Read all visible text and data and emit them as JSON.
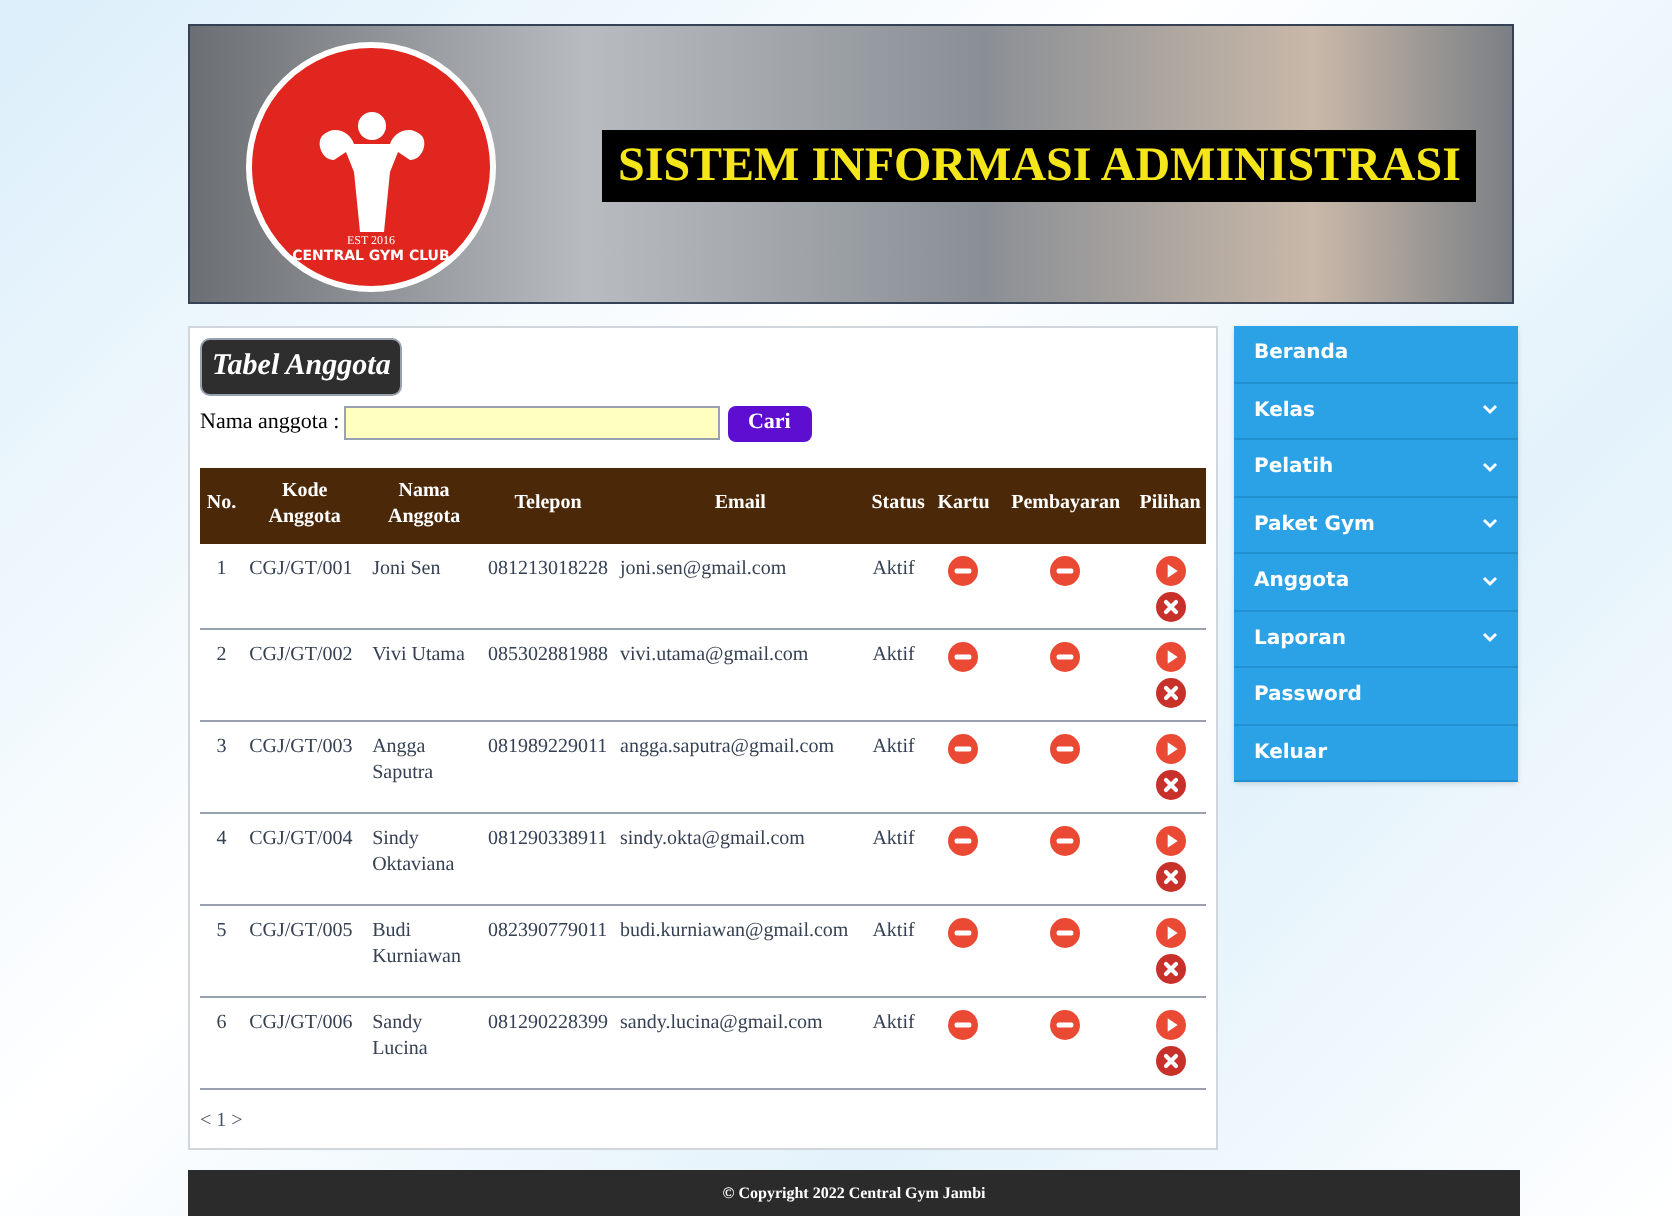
{
  "banner": {
    "title": "SISTEM INFORMASI ADMINISTRASI",
    "logo_text": "CENTRAL GYM CLUB",
    "logo_est": "EST 2016"
  },
  "panel": {
    "title": "Tabel Anggota",
    "search": {
      "label": "Nama anggota :",
      "button": "Cari"
    },
    "table": {
      "columns": [
        "No.",
        "Kode Anggota",
        "Nama Anggota",
        "Telepon",
        "Email",
        "Status",
        "Kartu",
        "Pembayaran",
        "Pilihan"
      ],
      "rows": [
        {
          "no": "1",
          "kode": "CGJ/GT/001",
          "nama": "Joni Sen",
          "telepon": "081213018228",
          "email": "joni.sen@gmail.com",
          "status": "Aktif"
        },
        {
          "no": "2",
          "kode": "CGJ/GT/002",
          "nama": "Vivi Utama",
          "telepon": "085302881988",
          "email": "vivi.utama@gmail.com",
          "status": "Aktif"
        },
        {
          "no": "3",
          "kode": "CGJ/GT/003",
          "nama": "Angga Saputra",
          "telepon": "081989229011",
          "email": "angga.saputra@gmail.com",
          "status": "Aktif"
        },
        {
          "no": "4",
          "kode": "CGJ/GT/004",
          "nama": "Sindy Oktaviana",
          "telepon": "081290338911",
          "email": "sindy.okta@gmail.com",
          "status": "Aktif"
        },
        {
          "no": "5",
          "kode": "CGJ/GT/005",
          "nama": "Budi Kurniawan",
          "telepon": "082390779011",
          "email": "budi.kurniawan@gmail.com",
          "status": "Aktif"
        },
        {
          "no": "6",
          "kode": "CGJ/GT/006",
          "nama": "Sandy Lucina",
          "telepon": "081290228399",
          "email": "sandy.lucina@gmail.com",
          "status": "Aktif"
        }
      ]
    },
    "pagination": "< 1 >"
  },
  "sidebar": {
    "items": [
      {
        "label": "Beranda",
        "has_submenu": false
      },
      {
        "label": "Kelas",
        "has_submenu": true
      },
      {
        "label": "Pelatih",
        "has_submenu": true
      },
      {
        "label": "Paket Gym",
        "has_submenu": true
      },
      {
        "label": "Anggota",
        "has_submenu": true
      },
      {
        "label": "Laporan",
        "has_submenu": true
      },
      {
        "label": "Password",
        "has_submenu": false
      },
      {
        "label": "Keluar",
        "has_submenu": false
      }
    ]
  },
  "footer": "© Copyright 2022 Central Gym Jambi"
}
